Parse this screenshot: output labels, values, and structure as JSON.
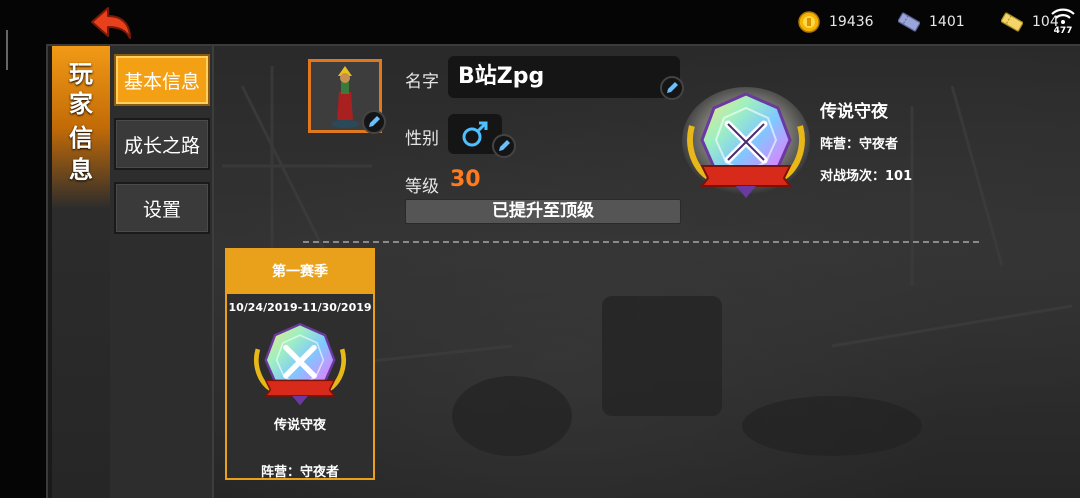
{
  "topbar": {
    "back_icon": "back-arrow-icon",
    "resources": [
      {
        "icon": "gold-coin-icon",
        "value": "19436"
      },
      {
        "icon": "ticket-icon",
        "value": "1401"
      },
      {
        "icon": "card-icon",
        "value": "104"
      }
    ],
    "signal": {
      "icon": "wifi-signal-icon",
      "value": "477"
    }
  },
  "title_tab": {
    "chars": [
      "玩",
      "家",
      "信",
      "息"
    ]
  },
  "menu": {
    "items": [
      {
        "label": "基本信息",
        "active": true
      },
      {
        "label": "成长之路",
        "active": false
      },
      {
        "label": "设置",
        "active": false
      }
    ]
  },
  "profile": {
    "name_label": "名字",
    "name_value": "B站Zpg",
    "gender_label": "性别",
    "gender_icon": "male-symbol-icon",
    "level_label": "等级",
    "level_value": "30",
    "max_level_text": "已提升至顶级"
  },
  "rank": {
    "title": "传说守夜",
    "camp": "阵营：守夜者",
    "battles": "对战场次：101",
    "badge_icon": "legend-nightwatch-badge-icon"
  },
  "season": {
    "header": "第一赛季",
    "dates": "10/24/2019-11/30/2019",
    "rank": "传说守夜",
    "camp": "阵营：守夜者"
  },
  "colors": {
    "accent_orange": "#f4a014",
    "level_orange": "#ff7b1c",
    "avatar_border": "#e07820"
  }
}
